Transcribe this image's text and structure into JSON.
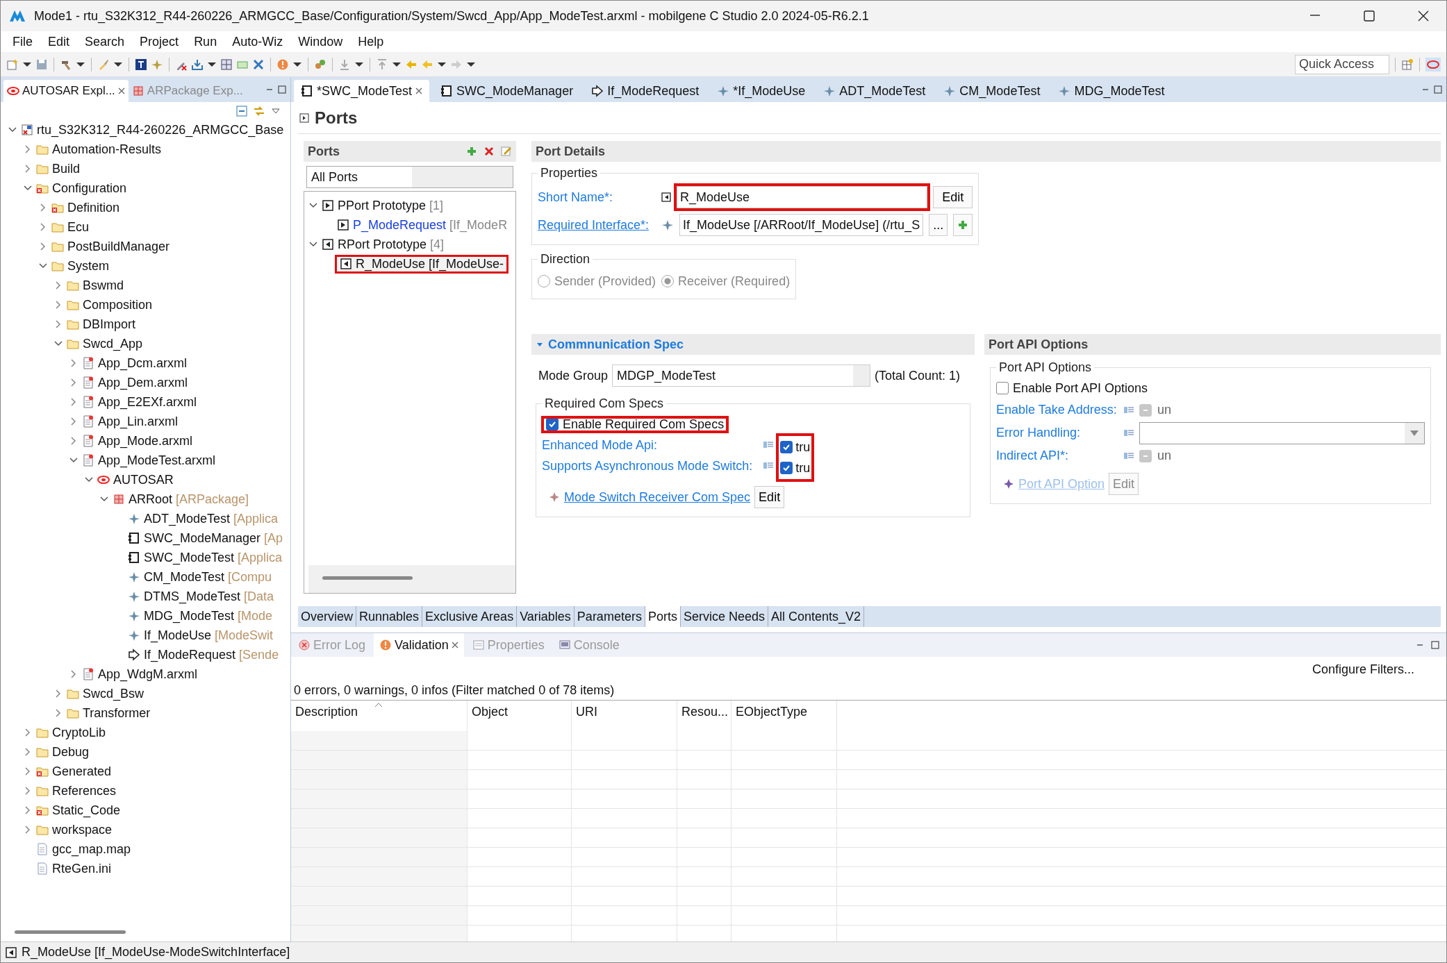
{
  "window": {
    "title": "Mode1 - rtu_S32K312_R44-260226_ARMGCC_Base/Configuration/System/Swcd_App/App_ModeTest.arxml - mobilgene C Studio 2.0 2024-05-R6.2.1"
  },
  "menu": [
    "File",
    "Edit",
    "Search",
    "Project",
    "Run",
    "Auto-Wiz",
    "Window",
    "Help"
  ],
  "quick_access": {
    "placeholder": "Quick Access"
  },
  "view_tabs": [
    {
      "label": "AUTOSAR Expl...",
      "kind": "autosar",
      "selected": true
    },
    {
      "label": "ARPackage Exp...",
      "kind": "package",
      "selected": false
    }
  ],
  "explorer": {
    "tree": [
      {
        "label": "rtu_S32K312_R44-260226_ARMGCC_Base",
        "kind": "project",
        "expanded": true,
        "children": [
          {
            "label": "Automation-Results",
            "kind": "folder",
            "expanded": false
          },
          {
            "label": "Build",
            "kind": "folder",
            "expanded": false
          },
          {
            "label": "Configuration",
            "kind": "folder-error",
            "expanded": true,
            "children": [
              {
                "label": "Definition",
                "kind": "folder-error",
                "expanded": false
              },
              {
                "label": "Ecu",
                "kind": "folder",
                "expanded": false
              },
              {
                "label": "PostBuildManager",
                "kind": "folder",
                "expanded": false
              },
              {
                "label": "System",
                "kind": "folder",
                "expanded": true,
                "children": [
                  {
                    "label": "Bswmd",
                    "kind": "folder",
                    "expanded": false
                  },
                  {
                    "label": "Composition",
                    "kind": "folder",
                    "expanded": false
                  },
                  {
                    "label": "DBImport",
                    "kind": "folder",
                    "expanded": false
                  },
                  {
                    "label": "Swcd_App",
                    "kind": "folder",
                    "expanded": true,
                    "children": [
                      {
                        "label": "App_Dcm.arxml",
                        "kind": "file",
                        "expanded": false
                      },
                      {
                        "label": "App_Dem.arxml",
                        "kind": "file",
                        "expanded": false
                      },
                      {
                        "label": "App_E2EXf.arxml",
                        "kind": "file",
                        "expanded": false
                      },
                      {
                        "label": "App_Lin.arxml",
                        "kind": "file",
                        "expanded": false
                      },
                      {
                        "label": "App_Mode.arxml",
                        "kind": "file",
                        "expanded": false
                      },
                      {
                        "label": "App_ModeTest.arxml",
                        "kind": "file",
                        "expanded": true,
                        "children": [
                          {
                            "label": "AUTOSAR",
                            "kind": "autosar",
                            "expanded": true,
                            "children": [
                              {
                                "label": "ARRoot",
                                "note": "[ARPackage]",
                                "kind": "package",
                                "expanded": true,
                                "children": [
                                  {
                                    "label": "ADT_ModeTest",
                                    "note": "[Applica",
                                    "kind": "element"
                                  },
                                  {
                                    "label": "SWC_ModeManager",
                                    "note": "[Ap",
                                    "kind": "component"
                                  },
                                  {
                                    "label": "SWC_ModeTest",
                                    "note": "[Applica",
                                    "kind": "component"
                                  },
                                  {
                                    "label": "CM_ModeTest",
                                    "note": "[Compu",
                                    "kind": "element"
                                  },
                                  {
                                    "label": "DTMS_ModeTest",
                                    "note": "[Data",
                                    "kind": "element"
                                  },
                                  {
                                    "label": "MDG_ModeTest",
                                    "note": "[Mode",
                                    "kind": "element"
                                  },
                                  {
                                    "label": "If_ModeUse",
                                    "note": "[ModeSwit",
                                    "kind": "element"
                                  },
                                  {
                                    "label": "If_ModeRequest",
                                    "note": "[Sende",
                                    "kind": "interface"
                                  }
                                ]
                              }
                            ]
                          }
                        ]
                      },
                      {
                        "label": "App_WdgM.arxml",
                        "kind": "file",
                        "expanded": false
                      }
                    ]
                  },
                  {
                    "label": "Swcd_Bsw",
                    "kind": "folder",
                    "expanded": false
                  },
                  {
                    "label": "Transformer",
                    "kind": "folder",
                    "expanded": false
                  }
                ]
              }
            ]
          },
          {
            "label": "CryptoLib",
            "kind": "folder",
            "expanded": false
          },
          {
            "label": "Debug",
            "kind": "folder",
            "expanded": false
          },
          {
            "label": "Generated",
            "kind": "folder-error",
            "expanded": false
          },
          {
            "label": "References",
            "kind": "folder",
            "expanded": false
          },
          {
            "label": "Static_Code",
            "kind": "folder-error",
            "expanded": false
          },
          {
            "label": "workspace",
            "kind": "folder",
            "expanded": false
          },
          {
            "label": "gcc_map.map",
            "kind": "document"
          },
          {
            "label": "RteGen.ini",
            "kind": "document"
          }
        ]
      }
    ]
  },
  "editor_tabs": [
    {
      "label": "*SWC_ModeTest",
      "kind": "component",
      "selected": true
    },
    {
      "label": "SWC_ModeManager",
      "kind": "component",
      "selected": false
    },
    {
      "label": "If_ModeRequest",
      "kind": "interface",
      "selected": false
    },
    {
      "label": "*If_ModeUse",
      "kind": "element",
      "selected": false
    },
    {
      "label": "ADT_ModeTest",
      "kind": "element",
      "selected": false
    },
    {
      "label": "CM_ModeTest",
      "kind": "element",
      "selected": false
    },
    {
      "label": "MDG_ModeTest",
      "kind": "element",
      "selected": false
    }
  ],
  "page": {
    "title": "Ports"
  },
  "ports_panel": {
    "title": "Ports",
    "filter": "All Ports",
    "tree": [
      {
        "label": "PPort Prototype",
        "note": "[1]",
        "kind": "port-p",
        "expanded": true,
        "children": [
          {
            "label": "P_ModeRequest",
            "note": "[If_ModeR",
            "kind": "port-p",
            "link": true,
            "annotated": false
          }
        ]
      },
      {
        "label": "RPort Prototype",
        "note": "[4]",
        "kind": "port-r",
        "expanded": true,
        "children": [
          {
            "label": "R_ModeUse [If_ModeUse-",
            "kind": "port-r",
            "link": false,
            "annotated": true
          }
        ]
      }
    ]
  },
  "port_details": {
    "title": "Port Details",
    "properties": {
      "title": "Properties",
      "short_name": {
        "label": "Short Name*:",
        "value": "R_ModeUse",
        "annotated": true,
        "button": "Edit"
      },
      "required_interface": {
        "label": "Required Interface*:",
        "value": "If_ModeUse [/ARRoot/If_ModeUse] (/rtu_S",
        "button": "..."
      }
    },
    "direction": {
      "title": "Direction",
      "options": [
        {
          "label": "Sender (Provided)",
          "selected": false,
          "disabled": true
        },
        {
          "label": "Receiver (Required)",
          "selected": true,
          "disabled": true
        }
      ]
    }
  },
  "com_spec": {
    "title": "Commnunication Spec",
    "expanded": true,
    "mode_group": {
      "label": "Mode Group",
      "value": "MDGP_ModeTest",
      "note": "(Total Count: 1)"
    },
    "required": {
      "title": "Required Com Specs",
      "enable": {
        "label": "Enable Required Com Specs",
        "checked": true,
        "annotated": true
      },
      "fields_annotated": true,
      "fields": [
        {
          "label": "Enhanced Mode Api:",
          "checked": true,
          "value": "tru"
        },
        {
          "label": "Supports Asynchronous Mode Switch:",
          "checked": true,
          "value": "tru"
        }
      ],
      "link": {
        "label": "Mode Switch Receiver Com Spec",
        "button": "Edit"
      }
    }
  },
  "port_api": {
    "title": "Port API Options",
    "group_title": "Port API Options",
    "enable": {
      "label": "Enable Port API Options",
      "checked": false
    },
    "fields": [
      {
        "kind": "tristate",
        "label": "Enable Take Address:",
        "value": "un",
        "disabled": true
      },
      {
        "kind": "dropdown",
        "label": "Error Handling:"
      },
      {
        "kind": "tristate",
        "label": "Indirect API*:",
        "value": "un",
        "disabled": true
      }
    ],
    "link": {
      "label": "Port API Option",
      "button": "Edit",
      "disabled": true
    }
  },
  "editor_pages": [
    {
      "label": "Overview",
      "selected": false
    },
    {
      "label": "Runnables",
      "selected": false
    },
    {
      "label": "Exclusive Areas",
      "selected": false
    },
    {
      "label": "Variables",
      "selected": false
    },
    {
      "label": "Parameters",
      "selected": false
    },
    {
      "label": "Ports",
      "selected": true
    },
    {
      "label": "Service Needs",
      "selected": false
    },
    {
      "label": "All Contents_V2",
      "selected": false
    }
  ],
  "bottom_view": {
    "tabs": [
      {
        "label": "Error Log",
        "kind": "error",
        "selected": false
      },
      {
        "label": "Validation",
        "kind": "warning",
        "selected": true
      },
      {
        "label": "Properties",
        "kind": "properties",
        "selected": false
      },
      {
        "label": "Console",
        "kind": "console",
        "selected": false
      }
    ],
    "configure": "Configure Filters...",
    "summary": "0 errors, 0 warnings, 0 infos (Filter matched 0 of 78 items)",
    "columns": [
      "Description",
      "Object",
      "URI",
      "Resou...",
      "EObjectType"
    ]
  },
  "status_bar": {
    "text": "R_ModeUse [If_ModeUse-ModeSwitchInterface]"
  }
}
